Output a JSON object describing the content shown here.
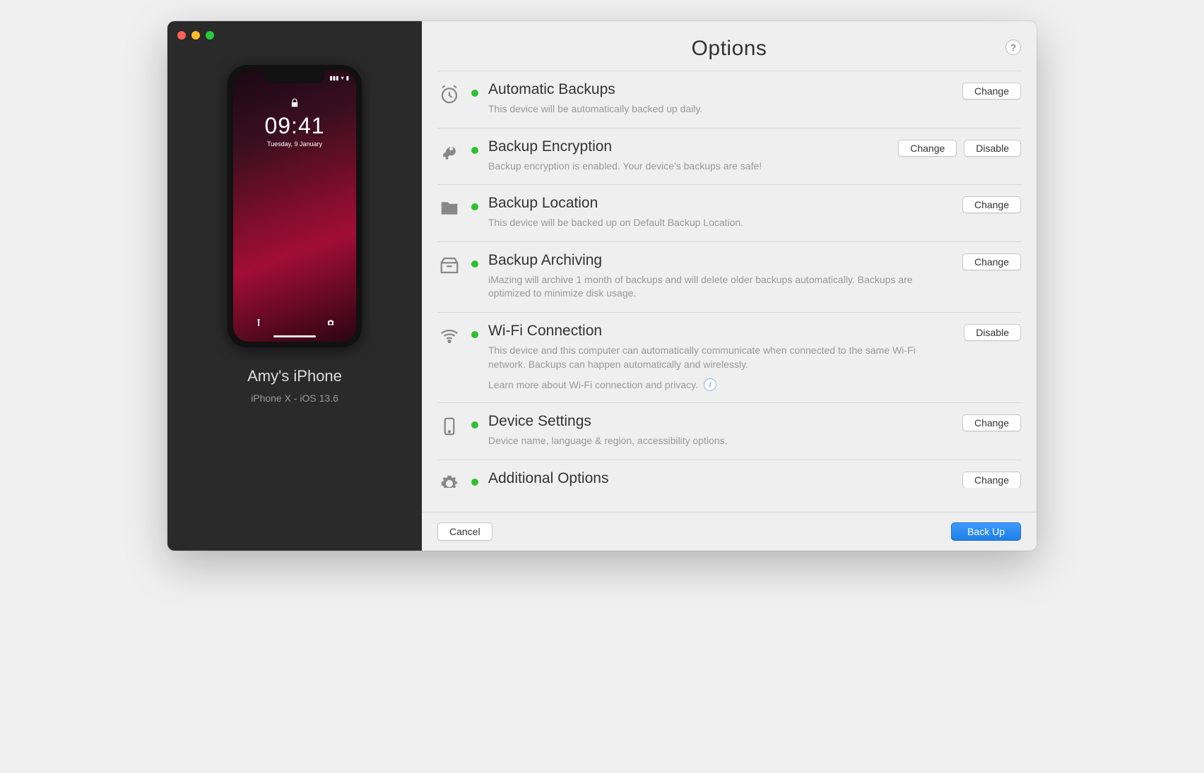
{
  "header": {
    "title": "Options",
    "help": "?"
  },
  "device": {
    "name": "Amy's iPhone",
    "model_line": "iPhone X - iOS 13.6",
    "screen": {
      "time": "09:41",
      "date": "Tuesday, 9 January"
    }
  },
  "options": {
    "auto_backup": {
      "title": "Automatic Backups",
      "desc": "This device will be automatically backed up daily.",
      "change": "Change"
    },
    "encryption": {
      "title": "Backup Encryption",
      "desc": "Backup encryption is enabled. Your device's backups are safe!",
      "change": "Change",
      "disable": "Disable"
    },
    "location": {
      "title": "Backup Location",
      "desc": "This device will be backed up on Default Backup Location.",
      "change": "Change"
    },
    "archiving": {
      "title": "Backup Archiving",
      "desc": "iMazing will archive 1 month of backups and will delete older backups automatically. Backups are optimized to minimize disk usage.",
      "change": "Change"
    },
    "wifi": {
      "title": "Wi-Fi Connection",
      "desc": "This device and this computer can automatically communicate when connected to the same Wi-Fi network. Backups can happen automatically and wirelessly.",
      "learn": "Learn more about Wi-Fi connection and privacy.",
      "disable": "Disable"
    },
    "device_settings": {
      "title": "Device Settings",
      "desc": "Device name, language & region, accessibility options.",
      "change": "Change"
    },
    "additional": {
      "title": "Additional Options",
      "change": "Change"
    }
  },
  "footer": {
    "cancel": "Cancel",
    "backup": "Back Up"
  }
}
